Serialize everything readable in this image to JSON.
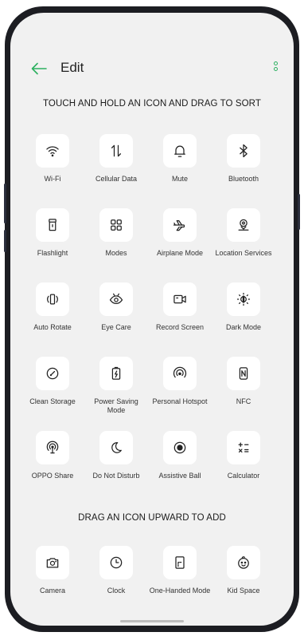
{
  "header": {
    "title": "Edit"
  },
  "colors": {
    "accent": "#2cb060",
    "screen_bg": "#f1f1f1",
    "tile_bg": "#ffffff"
  },
  "sections": {
    "active_title": "TOUCH AND HOLD AN ICON AND DRAG TO SORT",
    "add_title": "DRAG AN ICON UPWARD TO ADD"
  },
  "active_tiles": [
    {
      "label": "Wi-Fi",
      "icon": "wifi-icon"
    },
    {
      "label": "Cellular Data",
      "icon": "cellular-data-icon"
    },
    {
      "label": "Mute",
      "icon": "bell-icon"
    },
    {
      "label": "Bluetooth",
      "icon": "bluetooth-icon"
    },
    {
      "label": "Flashlight",
      "icon": "flashlight-icon"
    },
    {
      "label": "Modes",
      "icon": "modes-grid-icon"
    },
    {
      "label": "Airplane Mode",
      "icon": "airplane-icon"
    },
    {
      "label": "Location Services",
      "icon": "location-icon"
    },
    {
      "label": "Auto Rotate",
      "icon": "rotate-icon"
    },
    {
      "label": "Eye Care",
      "icon": "eye-icon"
    },
    {
      "label": "Record Screen",
      "icon": "video-camera-icon"
    },
    {
      "label": "Dark Mode",
      "icon": "sun-icon"
    },
    {
      "label": "Clean Storage",
      "icon": "gauge-icon"
    },
    {
      "label": "Power Saving Mode",
      "icon": "battery-icon"
    },
    {
      "label": "Personal Hotspot",
      "icon": "hotspot-icon"
    },
    {
      "label": "NFC",
      "icon": "nfc-icon"
    },
    {
      "label": "OPPO Share",
      "icon": "share-broadcast-icon"
    },
    {
      "label": "Do Not Disturb",
      "icon": "moon-icon"
    },
    {
      "label": "Assistive Ball",
      "icon": "target-dot-icon"
    },
    {
      "label": "Calculator",
      "icon": "calculator-icon"
    }
  ],
  "add_tiles": [
    {
      "label": "Camera",
      "icon": "camera-icon"
    },
    {
      "label": "Clock",
      "icon": "clock-icon"
    },
    {
      "label": "One-Handed Mode",
      "icon": "one-handed-icon"
    },
    {
      "label": "Kid Space",
      "icon": "kid-face-icon"
    }
  ]
}
